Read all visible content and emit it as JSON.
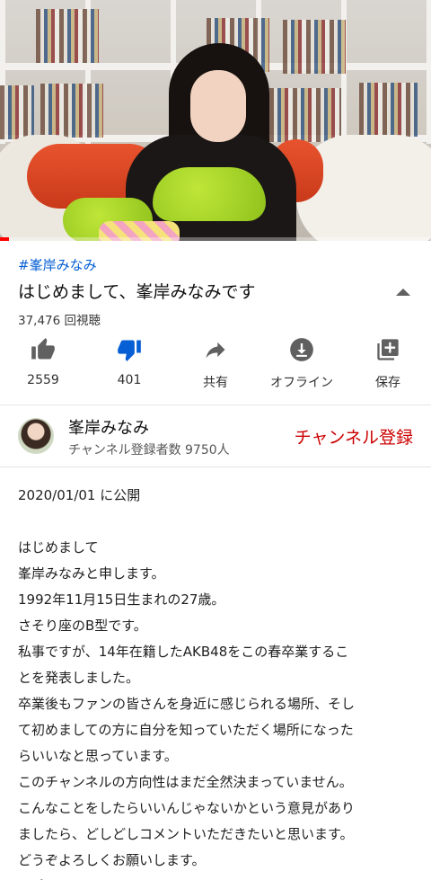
{
  "video": {
    "progress_fraction": 0.02
  },
  "hashtag": "#峯岸みなみ",
  "title": "はじめまして、峯岸みなみです",
  "views": "37,476 回視聴",
  "actions": [
    {
      "icon": "thumb-up-icon",
      "label": "2559"
    },
    {
      "icon": "thumb-down-icon",
      "label": "401"
    },
    {
      "icon": "share-icon",
      "label": "共有"
    },
    {
      "icon": "download-icon",
      "label": "オフライン"
    },
    {
      "icon": "save-playlist-icon",
      "label": "保存"
    }
  ],
  "colors": {
    "accent_blue": "#065fd4",
    "dislike_active": "#065fd4",
    "subscribe_red": "#cc0000"
  },
  "channel": {
    "name": "峯岸みなみ",
    "subscribers": "チャンネル登録者数 9750人",
    "subscribe_label": "チャンネル登録"
  },
  "description": {
    "date": "2020/01/01 に公開",
    "lines": [
      "はじめまして",
      "峯岸みなみと申します。",
      "1992年11月15日生まれの27歳。",
      "さそり座のB型です。",
      "私事ですが、14年在籍したAKB48をこの春卒業するこ",
      "とを発表しました。",
      "卒業後もファンの皆さんを身近に感じられる場所、そし",
      "て初めましての方に自分を知っていただく場所になった",
      "らいいなと思っています。",
      "このチャンネルの方向性はまだ全然決まっていません。",
      "こんなことをしたらいいんじゃないかという意見があり",
      "ましたら、どしどしコメントいただきたいと思います。",
      "どうぞよろしくお願いします。",
      "お手柔らかに. . ."
    ]
  }
}
